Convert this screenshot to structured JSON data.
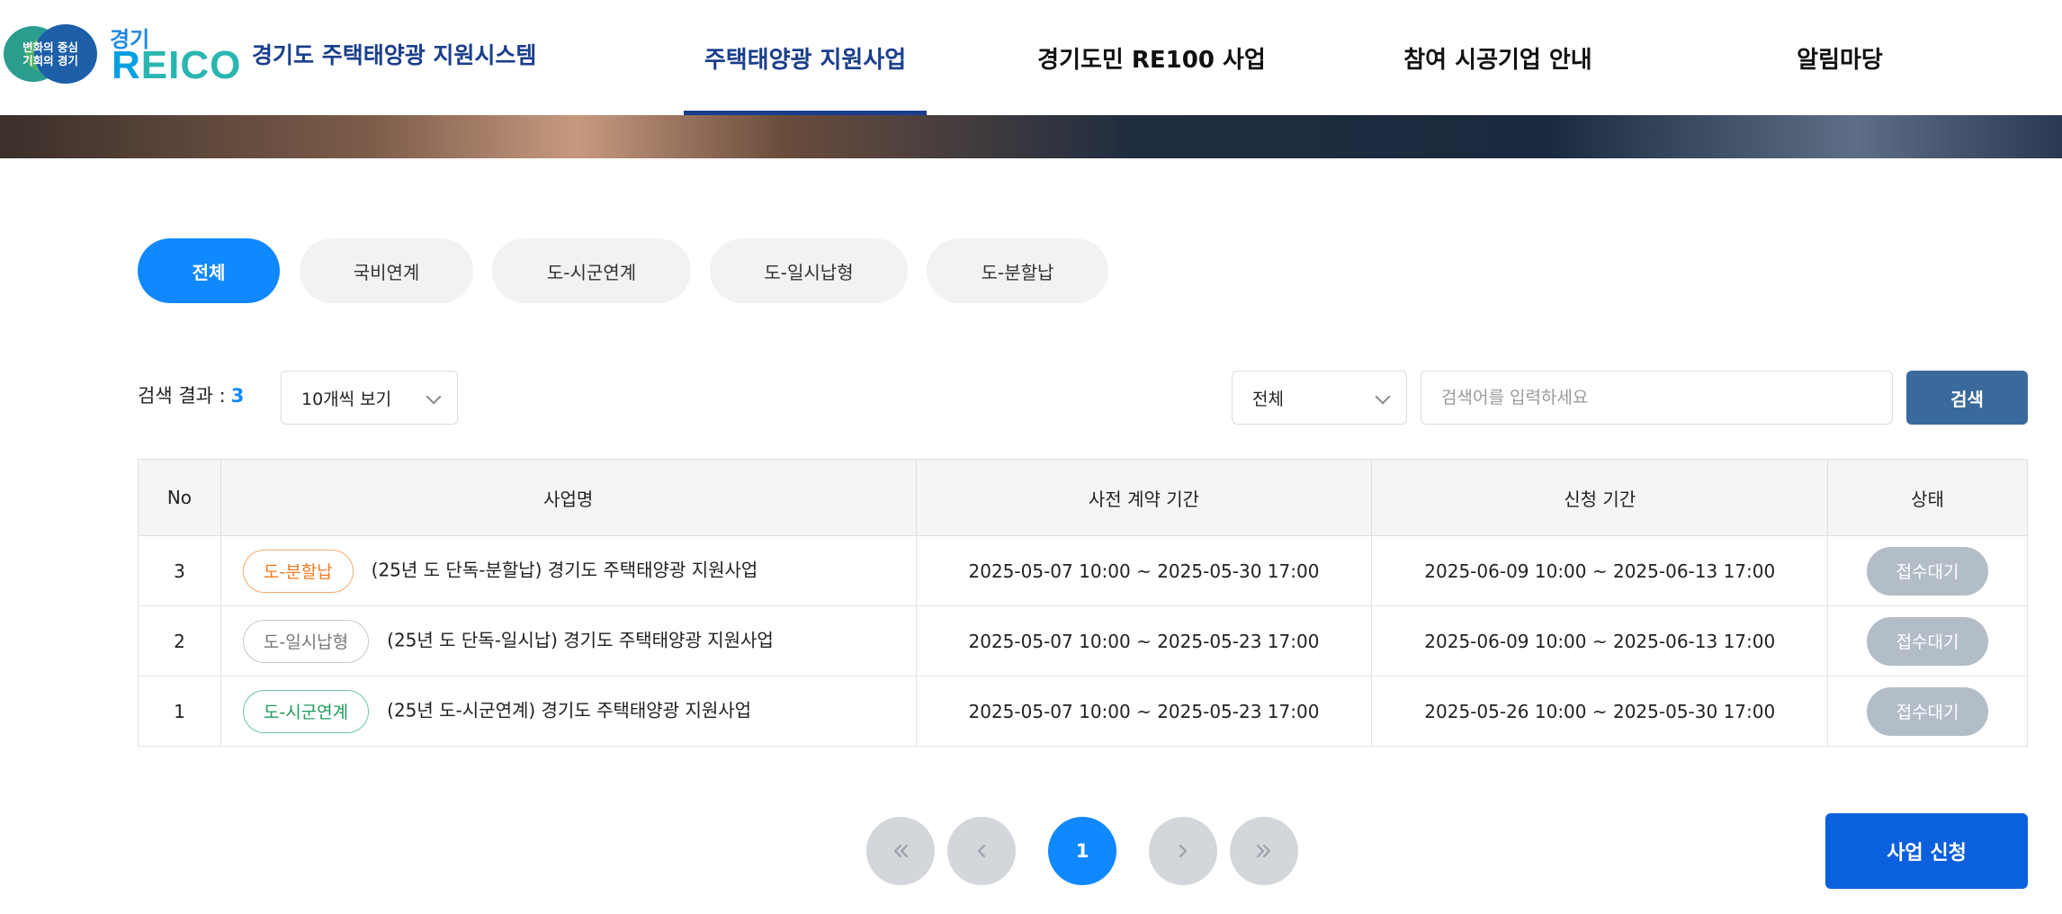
{
  "header": {
    "logo_badge_line1": "변화의 중심",
    "logo_badge_line2": "기회의 경기",
    "brand_small": "경기",
    "brand_main": "REICO",
    "site_title": "경기도 주택태양광 지원시스템",
    "nav": [
      {
        "label": "주택태양광 지원사업",
        "active": true
      },
      {
        "label": "경기도민 RE100 사업",
        "active": false
      },
      {
        "label": "참여 시공기업 안내",
        "active": false
      },
      {
        "label": "알림마당",
        "active": false
      }
    ]
  },
  "categories": [
    "전체",
    "국비연계",
    "도-시군연계",
    "도-일시납형",
    "도-분할납"
  ],
  "categories_active": "전체",
  "search": {
    "result_label": "검색 결과 :",
    "result_count": "3",
    "page_size": "10개씩 보기",
    "field_select": "전체",
    "placeholder": "검색어를 입력하세요",
    "button": "검색"
  },
  "table": {
    "headers": [
      "No",
      "사업명",
      "사전 계약 기간",
      "신청 기간",
      "상태"
    ],
    "rows": [
      {
        "no": "3",
        "tag": "도-분할납",
        "tag_color": "#f07b1f",
        "name": "(25년 도 단독-분할납) 경기도 주택태양광 지원사업",
        "contract": "2025-05-07 10:00 ~ 2025-05-30 17:00",
        "apply": "2025-06-09 10:00 ~ 2025-06-13 17:00",
        "status": "접수대기"
      },
      {
        "no": "2",
        "tag": "도-일시납형",
        "tag_color": "#777777",
        "name": "(25년 도 단독-일시납) 경기도 주택태양광 지원사업",
        "contract": "2025-05-07 10:00 ~ 2025-05-23 17:00",
        "apply": "2025-06-09 10:00 ~ 2025-06-13 17:00",
        "status": "접수대기"
      },
      {
        "no": "1",
        "tag": "도-시군연계",
        "tag_color": "#1e9a5a",
        "name": "(25년 도-시군연계) 경기도 주택태양광 지원사업",
        "contract": "2025-05-07 10:00 ~ 2025-05-23 17:00",
        "apply": "2025-05-26 10:00 ~ 2025-05-30 17:00",
        "status": "접수대기"
      }
    ]
  },
  "pagination": {
    "current_page": "1",
    "icons": [
      "double-chevron-left-icon",
      "chevron-left-icon",
      "chevron-right-icon",
      "double-chevron-right-icon"
    ]
  },
  "apply_button": "사업 신청",
  "colors": {
    "primary": "#1088ff",
    "navy": "#1a3e8c",
    "search_button": "#3a6a9c",
    "apply_button": "#0a60dd",
    "status_badge": "#b3bdc8"
  }
}
